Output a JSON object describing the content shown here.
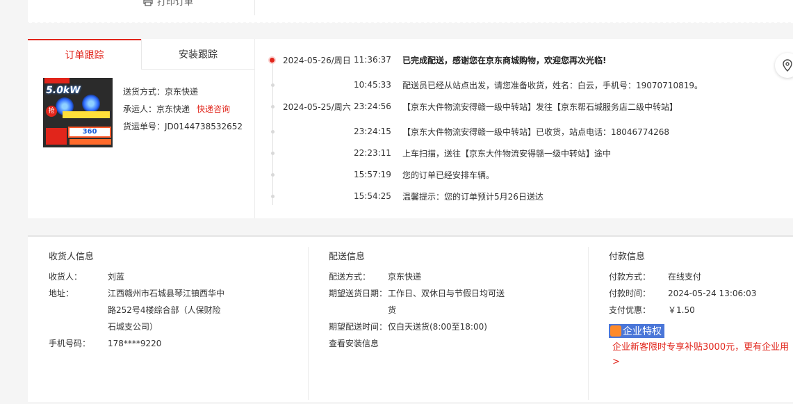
{
  "top": {
    "print_order_label": "打印订单"
  },
  "tabs": {
    "order_tracking": "订单跟踪",
    "install_tracking": "安装跟踪"
  },
  "product": {
    "image_text": "5.0kW",
    "promo_text": "360"
  },
  "shipping": {
    "method_label": "送货方式：",
    "method": "京东快递",
    "carrier_label": "承运人：",
    "carrier": "京东快递",
    "consult_link": "快递咨询",
    "waybill_label": "货运单号：",
    "waybill": "JD0144738532652"
  },
  "timeline": [
    {
      "date": "2024-05-26/周日",
      "time": "11:36:37",
      "message": "已完成配送，感谢您在京东商城购物，欢迎您再次光临!",
      "bold": true
    },
    {
      "date": "",
      "time": "10:45:33",
      "message": "配送员已经从站点出发，请您准备收货，姓名：白云，手机号：19070710819。"
    },
    {
      "date": "2024-05-25/周六",
      "time": "23:24:56",
      "message": "【京东大件物流安得赣一级中转站】发往【京东帮石城服务店二级中转站】"
    },
    {
      "date": "",
      "time": "23:24:15",
      "message": "【京东大件物流安得赣一级中转站】已收货，站点电话：18046774268"
    },
    {
      "date": "",
      "time": "22:23:11",
      "message": "上车扫描，送往【京东大件物流安得赣一级中转站】途中"
    },
    {
      "date": "",
      "time": "15:57:19",
      "message": "您的订单已经安排车辆。"
    },
    {
      "date": "",
      "time": "15:54:25",
      "message": "温馨提示：您的订单预计5月26日送达"
    }
  ],
  "receiver": {
    "title": "收货人信息",
    "name_label": "收货人：",
    "name": "刘蓝",
    "address_label": "地址：",
    "address": "江西赣州市石城县琴江镇西华中路252号4楼综合部（人保财险石城支公司）",
    "phone_label": "手机号码：",
    "phone": "178****9220"
  },
  "delivery": {
    "title": "配送信息",
    "method_label": "配送方式：",
    "method": "京东快递",
    "expected_date_label": "期望送货日期：",
    "expected_date": "工作日、双休日与节假日均可送货",
    "expected_time_label": "期望配送时间：",
    "expected_time": "仅白天送货(8:00至18:00)",
    "install_link": "查看安装信息"
  },
  "payment": {
    "title": "付款信息",
    "method_label": "付款方式：",
    "method": "在线支付",
    "time_label": "付款时间：",
    "time": "2024-05-24 13:06:03",
    "discount_label": "支付优惠：",
    "discount": "￥1.50",
    "enterprise_badge": "企业特权",
    "enterprise_text": "企业新客限时专享补贴3000元，更有企业用",
    "enterprise_arrow": ">"
  },
  "colors": {
    "accent": "#e1251b",
    "badge_blue": "#4a76d8"
  }
}
